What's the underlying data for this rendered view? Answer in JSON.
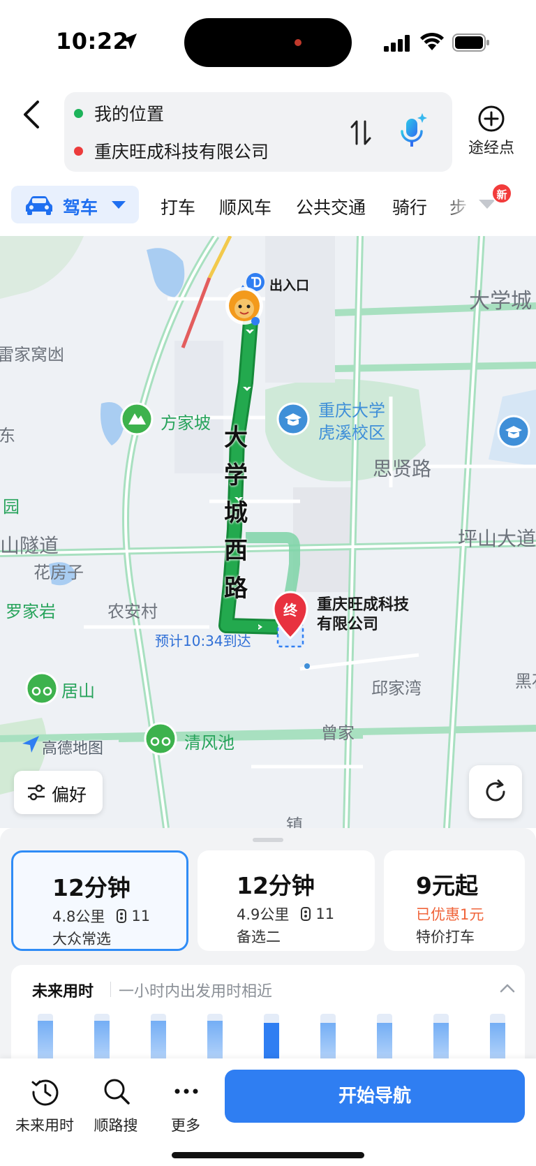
{
  "status_bar": {
    "time": "10:22"
  },
  "search": {
    "origin": "我的位置",
    "origin_color": "#1db35a",
    "destination": "重庆旺成科技有限公司",
    "destination_color": "#ec3b3b",
    "waypoint_label": "途经点"
  },
  "modes": {
    "active": "驾车",
    "tabs": [
      "打车",
      "顺风车",
      "公共交通",
      "骑行",
      "步"
    ],
    "new_badge": "新",
    "accent": "#1f6ff0"
  },
  "map": {
    "entrance_label": "出入口",
    "road_name": "大学城西路",
    "eta_tip": "预计10:34到达",
    "end_marker": "终",
    "destination_line1": "重庆旺成科技",
    "destination_line2": "有限公司",
    "places": {
      "leijiawo": "雷家窝凼",
      "fangjiapo": "方家坡",
      "chongqing_univ_1": "重庆大学",
      "chongqing_univ_2": "虎溪校区",
      "daxuecheng": "大学城",
      "sixian": "思贤路",
      "pingshan_tunnel": "山隧道",
      "pingshan_ave": "坪山大道",
      "huafangzi": "花房子",
      "luojiayan": "罗家岩",
      "nonganc": "农安村",
      "qiujiawan": "邱家湾",
      "zengjia": "曾家",
      "qingfengchi": "清风池",
      "jushan": "居山",
      "heishi": "黑石",
      "dong": "东",
      "yuan": "园",
      "zhen": "镇"
    },
    "logo_text": "高德地图",
    "preference_label": "偏好",
    "route_color": "#23a94e"
  },
  "routes": [
    {
      "time": "12分钟",
      "distance": "4.8公里",
      "lights": "11",
      "tag": "大众常选",
      "selected": true
    },
    {
      "time": "12分钟",
      "distance": "4.9公里",
      "lights": "11",
      "tag": "备选二",
      "selected": false
    },
    {
      "time": "9元起",
      "discount": "已优惠1元",
      "tag": "特价打车"
    }
  ],
  "future_time": {
    "title": "未来用时",
    "subtitle": "一小时内出发用时相近",
    "bars": [
      0.85,
      0.85,
      0.85,
      0.85,
      0.82,
      0.82,
      0.82,
      0.82,
      0.82
    ],
    "current_index": 4
  },
  "toolbar": {
    "future_label": "未来用时",
    "search_along_label": "顺路搜",
    "more_label": "更多",
    "start_label": "开始导航"
  }
}
